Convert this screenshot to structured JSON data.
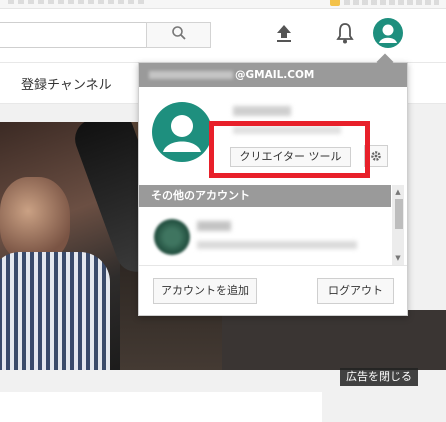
{
  "masthead": {
    "search": {
      "value": ""
    },
    "icons": [
      "search-icon",
      "upload-icon",
      "notification-bell-icon",
      "avatar-icon"
    ]
  },
  "guide": {
    "subscriptions_label": "登録チャンネル"
  },
  "ad": {
    "close_label": "広告を閉じる"
  },
  "account_menu": {
    "email_suffix": "@GMAIL.COM",
    "creator_tools_label": "クリエイター ツール",
    "settings_icon": "gear-icon",
    "other_accounts_header": "その他のアカウント",
    "add_account_label": "アカウントを追加",
    "logout_label": "ログアウト"
  },
  "colors": {
    "highlight": "#e8202a",
    "avatar_green": "#1e8f7e",
    "menu_header_gray": "#9a9a9a"
  }
}
